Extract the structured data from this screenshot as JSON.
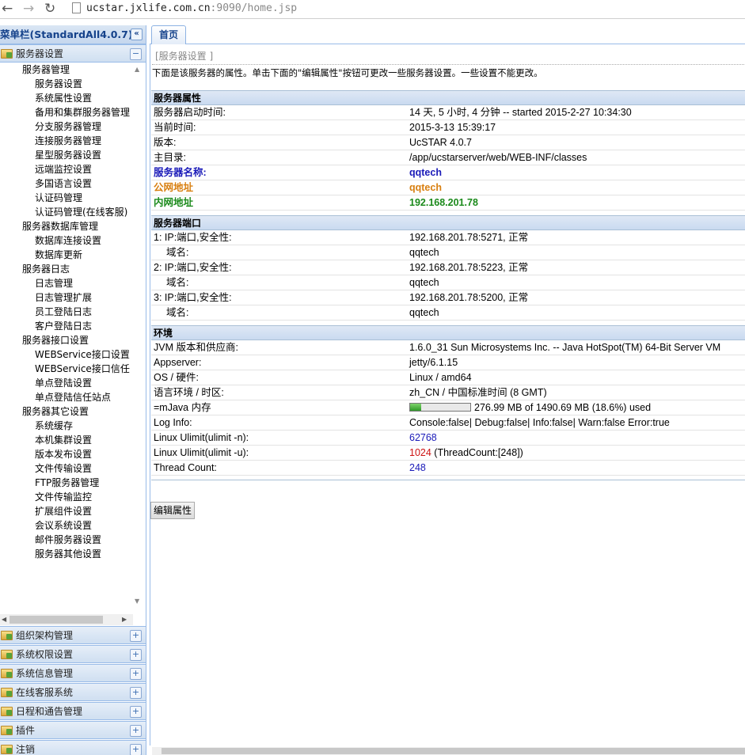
{
  "browser": {
    "url_host": "ucstar.jxlife.com.cn",
    "url_port": ":9090",
    "url_path": "/home.jsp",
    "back": "←",
    "forward": "→",
    "reload": "↻"
  },
  "sidebar": {
    "title": "菜单栏(StandardAll4.0.7)",
    "collapse_icon": "«",
    "open_panel": "服务器设置",
    "open_toggle": "−",
    "tree": [
      {
        "label": "服务器管理",
        "level": 1
      },
      {
        "label": "服务器设置",
        "level": 2
      },
      {
        "label": "系统属性设置",
        "level": 2
      },
      {
        "label": "备用和集群服务器管理",
        "level": 2
      },
      {
        "label": "分支服务器管理",
        "level": 2
      },
      {
        "label": "连接服务器管理",
        "level": 2
      },
      {
        "label": "星型服务器设置",
        "level": 2
      },
      {
        "label": "远端监控设置",
        "level": 2
      },
      {
        "label": "多国语言设置",
        "level": 2
      },
      {
        "label": "认证码管理",
        "level": 2
      },
      {
        "label": "认证码管理(在线客服)",
        "level": 2
      },
      {
        "label": "服务器数据库管理",
        "level": 1
      },
      {
        "label": "数据库连接设置",
        "level": 2
      },
      {
        "label": "数据库更新",
        "level": 2
      },
      {
        "label": "服务器日志",
        "level": 1
      },
      {
        "label": "日志管理",
        "level": 2
      },
      {
        "label": "日志管理扩展",
        "level": 2
      },
      {
        "label": "员工登陆日志",
        "level": 2
      },
      {
        "label": "客户登陆日志",
        "level": 2
      },
      {
        "label": "服务器接口设置",
        "level": 1
      },
      {
        "label": "WEBService接口设置",
        "level": 2
      },
      {
        "label": "WEBService接口信任",
        "level": 2
      },
      {
        "label": "单点登陆设置",
        "level": 2
      },
      {
        "label": "单点登陆信任站点",
        "level": 2
      },
      {
        "label": "服务器其它设置",
        "level": 1
      },
      {
        "label": "系统缓存",
        "level": 2
      },
      {
        "label": "本机集群设置",
        "level": 2
      },
      {
        "label": "版本发布设置",
        "level": 2
      },
      {
        "label": "文件传输设置",
        "level": 2
      },
      {
        "label": "FTP服务器管理",
        "level": 2
      },
      {
        "label": "文件传输监控",
        "level": 2
      },
      {
        "label": "扩展组件设置",
        "level": 2
      },
      {
        "label": "会议系统设置",
        "level": 2
      },
      {
        "label": "邮件服务器设置",
        "level": 2
      },
      {
        "label": "服务器其他设置",
        "level": 2
      }
    ],
    "panels": [
      {
        "label": "组织架构管理",
        "toggle": "+"
      },
      {
        "label": "系统权限设置",
        "toggle": "+"
      },
      {
        "label": "系统信息管理",
        "toggle": "+"
      },
      {
        "label": "在线客服系统",
        "toggle": "+"
      },
      {
        "label": "日程和通告管理",
        "toggle": "+"
      },
      {
        "label": "插件",
        "toggle": "+"
      },
      {
        "label": "注销",
        "toggle": "+"
      }
    ]
  },
  "tabs": {
    "home": "首页"
  },
  "main": {
    "breadcrumb": "[服务器设置 ]",
    "intro": "下面是该服务器的属性。单击下面的\"编辑属性\"按钮可更改一些服务器设置。一些设置不能更改。",
    "sections": {
      "props": {
        "title": "服务器属性",
        "rows": [
          {
            "k": "服务器启动时间:",
            "v": "14 天, 5 小时, 4 分钟 -- started 2015-2-27 10:34:30"
          },
          {
            "k": "当前时间:",
            "v": "2015-3-13 15:39:17"
          },
          {
            "k": "版本:",
            "v": "UcSTAR 4.0.7"
          },
          {
            "k": "主目录:",
            "v": "/app/ucstarserver/web/WEB-INF/classes"
          },
          {
            "k": "服务器名称:",
            "v": "qqtech",
            "style": "blue"
          },
          {
            "k": "公网地址",
            "v": "qqtech",
            "style": "orange"
          },
          {
            "k": "内网地址",
            "v": "192.168.201.78",
            "style": "green"
          }
        ]
      },
      "ports": {
        "title": "服务器端口",
        "rows": [
          {
            "k": "1: IP:端口,安全性:",
            "v": "192.168.201.78:5271, 正常"
          },
          {
            "k": "域名:",
            "v": "qqtech",
            "indent": true
          },
          {
            "k": "2: IP:端口,安全性:",
            "v": "192.168.201.78:5223, 正常"
          },
          {
            "k": "域名:",
            "v": "qqtech",
            "indent": true
          },
          {
            "k": "3: IP:端口,安全性:",
            "v": "192.168.201.78:5200, 正常"
          },
          {
            "k": "域名:",
            "v": "qqtech",
            "indent": true
          }
        ]
      },
      "env": {
        "title": "环境",
        "rows": [
          {
            "k": "JVM 版本和供应商:",
            "v": "1.6.0_31 Sun Microsystems Inc. -- Java HotSpot(TM) 64-Bit Server VM"
          },
          {
            "k": "Appserver:",
            "v": "jetty/6.1.15"
          },
          {
            "k": "OS / 硬件:",
            "v": "Linux / amd64"
          },
          {
            "k": "语言环境 / 时区:",
            "v": "zh_CN / 中国标准时间 (8 GMT)"
          },
          {
            "k": "=mJava 内存",
            "v": "276.99 MB of 1490.69 MB (18.6%) used",
            "memory_fraction": 0.186
          },
          {
            "k": "Log Info:",
            "v": "Console:false| Debug:false| Info:false| Warn:false Error:true"
          },
          {
            "k": "Linux Ulimit(ulimit -n):",
            "v": "62768",
            "style": "numblue"
          },
          {
            "k": "Linux Ulimit(ulimit -u):",
            "v_red": "1024",
            "v_rest": " (ThreadCount:[248])"
          },
          {
            "k": "Thread Count:",
            "v": "248",
            "style": "numblue"
          }
        ]
      }
    },
    "edit_button": "编辑属性"
  },
  "colors": {
    "accent": "#15428b",
    "border": "#99bbe8",
    "blue": "#1a1ab8",
    "orange": "#d87f10",
    "green": "#1b8a1b",
    "red": "#cc1111"
  }
}
